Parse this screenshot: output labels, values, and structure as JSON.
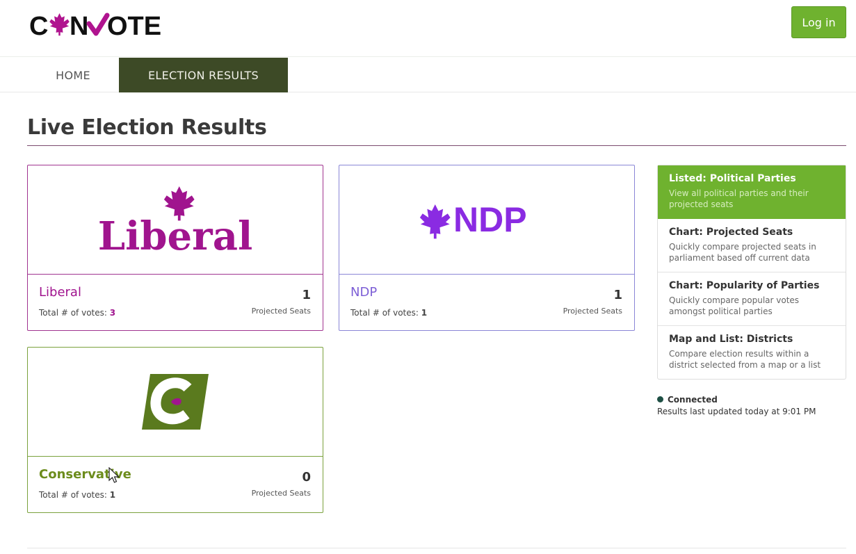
{
  "brand": {
    "logo_text": "CANVOTE",
    "accent": "#6fb22f",
    "nav_active_bg": "#3d4a26"
  },
  "header": {
    "login_label": "Log in"
  },
  "nav": {
    "tabs": [
      {
        "label": "HOME"
      },
      {
        "label": "ELECTION RESULTS",
        "active": true
      }
    ]
  },
  "page": {
    "title": "Live Election Results"
  },
  "parties": [
    {
      "name": "Liberal",
      "logo_text": "Liberal",
      "votes_label": "Total # of votes:",
      "votes": "3",
      "seats": "1",
      "seats_label": "Projected Seats",
      "color": "#a0148e"
    },
    {
      "name": "NDP",
      "logo_text": "NDP",
      "votes_label": "Total # of votes:",
      "votes": "1",
      "seats": "1",
      "seats_label": "Projected Seats",
      "color": "#8a2be2"
    },
    {
      "name": "Conservative",
      "logo_text": "C",
      "votes_label": "Total # of votes:",
      "votes": "1",
      "seats": "0",
      "seats_label": "Projected Seats",
      "color": "#5a7a1e"
    }
  ],
  "menu": {
    "items": [
      {
        "title": "Listed: Political Parties",
        "desc": "View all political parties and their projected seats",
        "active": true
      },
      {
        "title": "Chart: Projected Seats",
        "desc": "Quickly compare projected seats in parliament based off current data"
      },
      {
        "title": "Chart: Popularity of Parties",
        "desc": "Quickly compare popular votes amongst political parties"
      },
      {
        "title": "Map and List: Districts",
        "desc": "Compare election results within a district selected from a map or a list"
      }
    ]
  },
  "status": {
    "label": "Connected",
    "updated": "Results last updated today at 9:01 PM",
    "color": "#1e4f44"
  }
}
